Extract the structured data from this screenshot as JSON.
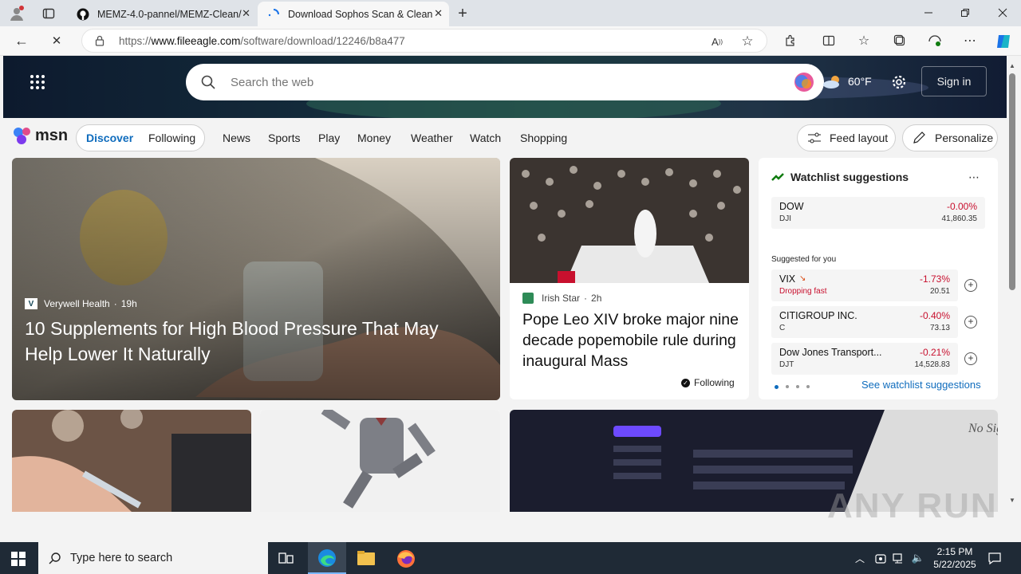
{
  "browser": {
    "tabs": [
      {
        "title": "MEMZ-4.0-pannel/MEMZ-Clean/",
        "icon": "github-icon"
      },
      {
        "title": "Download Sophos Scan & Clean",
        "icon": "loading-icon"
      }
    ],
    "url_prefix": "https://",
    "url_domain": "www.fileeagle.com",
    "url_path": "/software/download/12246/b8a477"
  },
  "msn": {
    "search_placeholder": "Search the web",
    "temperature": "60°F",
    "signin": "Sign in",
    "logo": "msn",
    "nav_pill": [
      "Discover",
      "Following"
    ],
    "nav_links": [
      "News",
      "Sports",
      "Play",
      "Money",
      "Weather",
      "Watch",
      "Shopping"
    ],
    "feed_layout": "Feed layout",
    "personalize": "Personalize"
  },
  "main_story": {
    "source": "Verywell Health",
    "time": "19h",
    "headline": "10 Supplements for High Blood Pressure That May Help Lower It Naturally"
  },
  "second_story": {
    "source": "Irish Star",
    "time": "2h",
    "headline": "Pope Leo XIV broke major nine decade popemobile rule during inaugural Mass",
    "following": "Following"
  },
  "watchlist": {
    "title": "Watchlist suggestions",
    "top": {
      "name": "DOW",
      "symbol": "DJI",
      "change": "-0.00%",
      "value": "41,860.35"
    },
    "suggested_label": "Suggested for you",
    "items": [
      {
        "name": "VIX",
        "sub": "Dropping fast",
        "change": "-1.73%",
        "value": "20.51"
      },
      {
        "name": "CITIGROUP INC.",
        "sub": "C",
        "change": "-0.40%",
        "value": "73.13"
      },
      {
        "name": "Dow Jones Transport...",
        "sub": "DJT",
        "change": "-0.21%",
        "value": "14,528.83"
      }
    ],
    "see_link": "See watchlist suggestions"
  },
  "taskbar": {
    "search_placeholder": "Type here to search",
    "time": "2:15 PM",
    "date": "5/22/2025"
  },
  "watermark": "ANY RUN"
}
